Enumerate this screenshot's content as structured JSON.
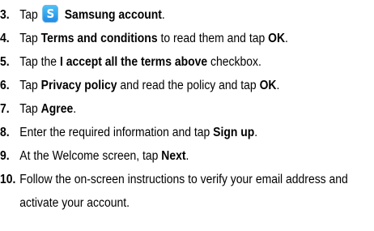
{
  "steps": [
    {
      "number": "3.",
      "parts": [
        {
          "t": "Tap ",
          "b": false
        },
        {
          "icon": "samsung-account-icon",
          "glyph": "S"
        },
        {
          "t": " Samsung account",
          "b": true
        },
        {
          "t": ".",
          "b": false
        }
      ]
    },
    {
      "number": "4.",
      "parts": [
        {
          "t": "Tap ",
          "b": false
        },
        {
          "t": "Terms and conditions",
          "b": true
        },
        {
          "t": " to read them and tap ",
          "b": false
        },
        {
          "t": "OK",
          "b": true
        },
        {
          "t": ".",
          "b": false
        }
      ]
    },
    {
      "number": "5.",
      "parts": [
        {
          "t": "Tap the ",
          "b": false
        },
        {
          "t": "I accept all the terms above",
          "b": true
        },
        {
          "t": " checkbox.",
          "b": false
        }
      ]
    },
    {
      "number": "6.",
      "parts": [
        {
          "t": "Tap ",
          "b": false
        },
        {
          "t": "Privacy policy",
          "b": true
        },
        {
          "t": " and read the policy and tap ",
          "b": false
        },
        {
          "t": "OK",
          "b": true
        },
        {
          "t": ".",
          "b": false
        }
      ]
    },
    {
      "number": "7.",
      "parts": [
        {
          "t": "Tap ",
          "b": false
        },
        {
          "t": "Agree",
          "b": true
        },
        {
          "t": ".",
          "b": false
        }
      ]
    },
    {
      "number": "8.",
      "parts": [
        {
          "t": "Enter the required information and tap ",
          "b": false
        },
        {
          "t": "Sign up",
          "b": true
        },
        {
          "t": ".",
          "b": false
        }
      ]
    },
    {
      "number": "9.",
      "parts": [
        {
          "t": "At the Welcome screen, tap ",
          "b": false
        },
        {
          "t": "Next",
          "b": true
        },
        {
          "t": ".",
          "b": false
        }
      ]
    },
    {
      "number": "10.",
      "parts": [
        {
          "t": "Follow the on-screen instructions to verify your email address and activate your account.",
          "b": false
        }
      ]
    }
  ]
}
